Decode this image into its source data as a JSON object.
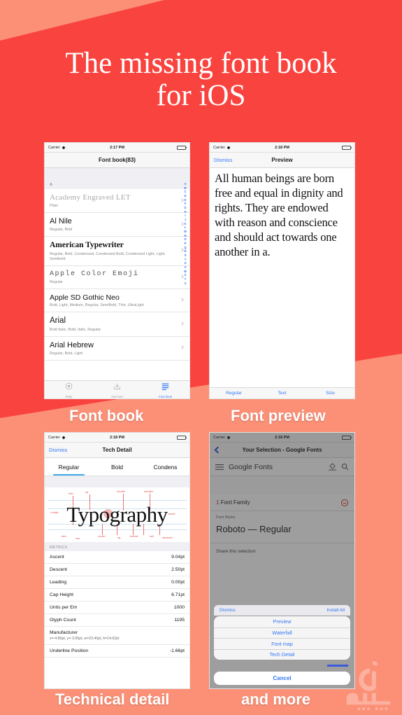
{
  "headline": {
    "line1": "The missing font book",
    "line2": "for iOS"
  },
  "colors": {
    "brand_red": "#f9433f",
    "brand_salmon": "#fb9077",
    "ios_blue": "#3478f6",
    "accent_teal": "#3da9e8"
  },
  "captions": {
    "font_book": "Font book",
    "font_preview": "Font preview",
    "technical_detail": "Technical detail",
    "and_more": "and more"
  },
  "phone1": {
    "status": {
      "carrier": "Carrier",
      "time": "2:17 PM",
      "wifi_icon": "wifi-icon",
      "battery_icon": "battery-icon"
    },
    "nav": {
      "title": "Font book(83)"
    },
    "section_header": "A",
    "fonts": [
      {
        "name": "Academy Engraved LET",
        "styles": "Plain",
        "style_class": "f-academy"
      },
      {
        "name": "Al Nile",
        "styles": "Regular, Bold",
        "style_class": "f-alnile"
      },
      {
        "name": "American Typewriter",
        "styles": "Regular, Bold, Condensed, Condensed Bold, Condensed Light, Light, Semibold",
        "style_class": "f-amtype"
      },
      {
        "name": "Apple Color Emoji",
        "styles": "Regular",
        "style_class": "f-emoji"
      },
      {
        "name": "Apple SD Gothic Neo",
        "styles": "Bold, Light, Medium, Regular, SemiBold, Thin, UltraLight",
        "style_class": "f-gothic"
      },
      {
        "name": "Arial",
        "styles": "Bold Italic, Bold, Italic, Regular",
        "style_class": "f-arial"
      },
      {
        "name": "Arial Hebrew",
        "styles": "Regular, Bold, Light",
        "style_class": "f-arialheb"
      }
    ],
    "index_letters": [
      "A",
      "B",
      "C",
      "D",
      "E",
      "F",
      "G",
      "H",
      "I",
      "J",
      "K",
      "L",
      "M",
      "N",
      "O",
      "P",
      "Q",
      "R",
      "S",
      "T",
      "U",
      "V",
      "W",
      "X",
      "Y",
      "Z"
    ],
    "tabs": [
      {
        "label": "Party",
        "icon": "circle-icon",
        "active": false
      },
      {
        "label": "Get Font",
        "icon": "download-tray-icon",
        "active": false
      },
      {
        "label": "Font book",
        "icon": "list-lines-icon",
        "active": true
      }
    ]
  },
  "phone2": {
    "status": {
      "carrier": "Carrier",
      "time": "2:18 PM",
      "wifi_icon": "wifi-icon",
      "battery_icon": "battery-icon"
    },
    "nav": {
      "left": "Dismiss",
      "title": "Preview"
    },
    "preview_text": "All human beings are born free and equal in dignity and rights. They are endowed with reason and conscience and should act towards one another in a.",
    "bottom_bar": [
      "Regular",
      "Text",
      "Size"
    ]
  },
  "phone3": {
    "status": {
      "carrier": "Carrier",
      "time": "2:18 PM",
      "wifi_icon": "wifi-icon",
      "battery_icon": "battery-icon"
    },
    "nav": {
      "left": "Dismiss",
      "title": "Tech Detail"
    },
    "segments": [
      {
        "label": "Regular",
        "active": true
      },
      {
        "label": "Bold",
        "active": false
      },
      {
        "label": "Condens",
        "active": false
      }
    ],
    "specimen_word": "Typography",
    "specimen_labels": [
      "bowl",
      "bar",
      "shoulder",
      "ascender",
      "x-height",
      "counter",
      "stem",
      "terminal",
      "serif",
      "descender",
      "leg",
      "loop"
    ],
    "metrics_header": "METRICS",
    "metrics": [
      {
        "label": "Ascent",
        "value": "9.04pt"
      },
      {
        "label": "Descent",
        "value": "2.50pt"
      },
      {
        "label": "Leading",
        "value": "0.00pt"
      },
      {
        "label": "Cap Height",
        "value": "6.71pt"
      },
      {
        "label": "Units per Em",
        "value": "1000"
      },
      {
        "label": "Glyph Count",
        "value": "1195"
      }
    ],
    "manufacturer": {
      "label": "Manufacturer",
      "sub": "x=-4.85pt, y=-3.65pt, w=23.40pt, h=14.62pt"
    },
    "underline": {
      "label": "Underline Position",
      "value": "-1.66pt"
    }
  },
  "phone4": {
    "status": {
      "carrier": "Carrier",
      "time": "2:18 PM",
      "wifi_icon": "wifi-icon",
      "battery_icon": "battery-icon"
    },
    "nav": {
      "back_icon": "back-chevron-icon",
      "title": "Your Selection - Google Fonts"
    },
    "web": {
      "menu_icon": "hamburger-menu-icon",
      "logo": "Google Fonts",
      "paint_icon": "paint-bucket-icon",
      "search_icon": "search-icon",
      "family_count": "1",
      "family_label": "Font Family",
      "remove_icon": "minus-circle-icon",
      "styles_label": "Font Styles",
      "style_value": "Roboto — Regular",
      "share_label": "Share this selection"
    },
    "sheet_bar": {
      "left": "Dismiss",
      "right": "Install All"
    },
    "sheet_items": [
      "Preview",
      "Waterfall",
      "Font map",
      "Tech Detail"
    ],
    "cancel": "Cancel"
  },
  "watermark": {
    "name": "arabic-apple-logo-watermark"
  }
}
